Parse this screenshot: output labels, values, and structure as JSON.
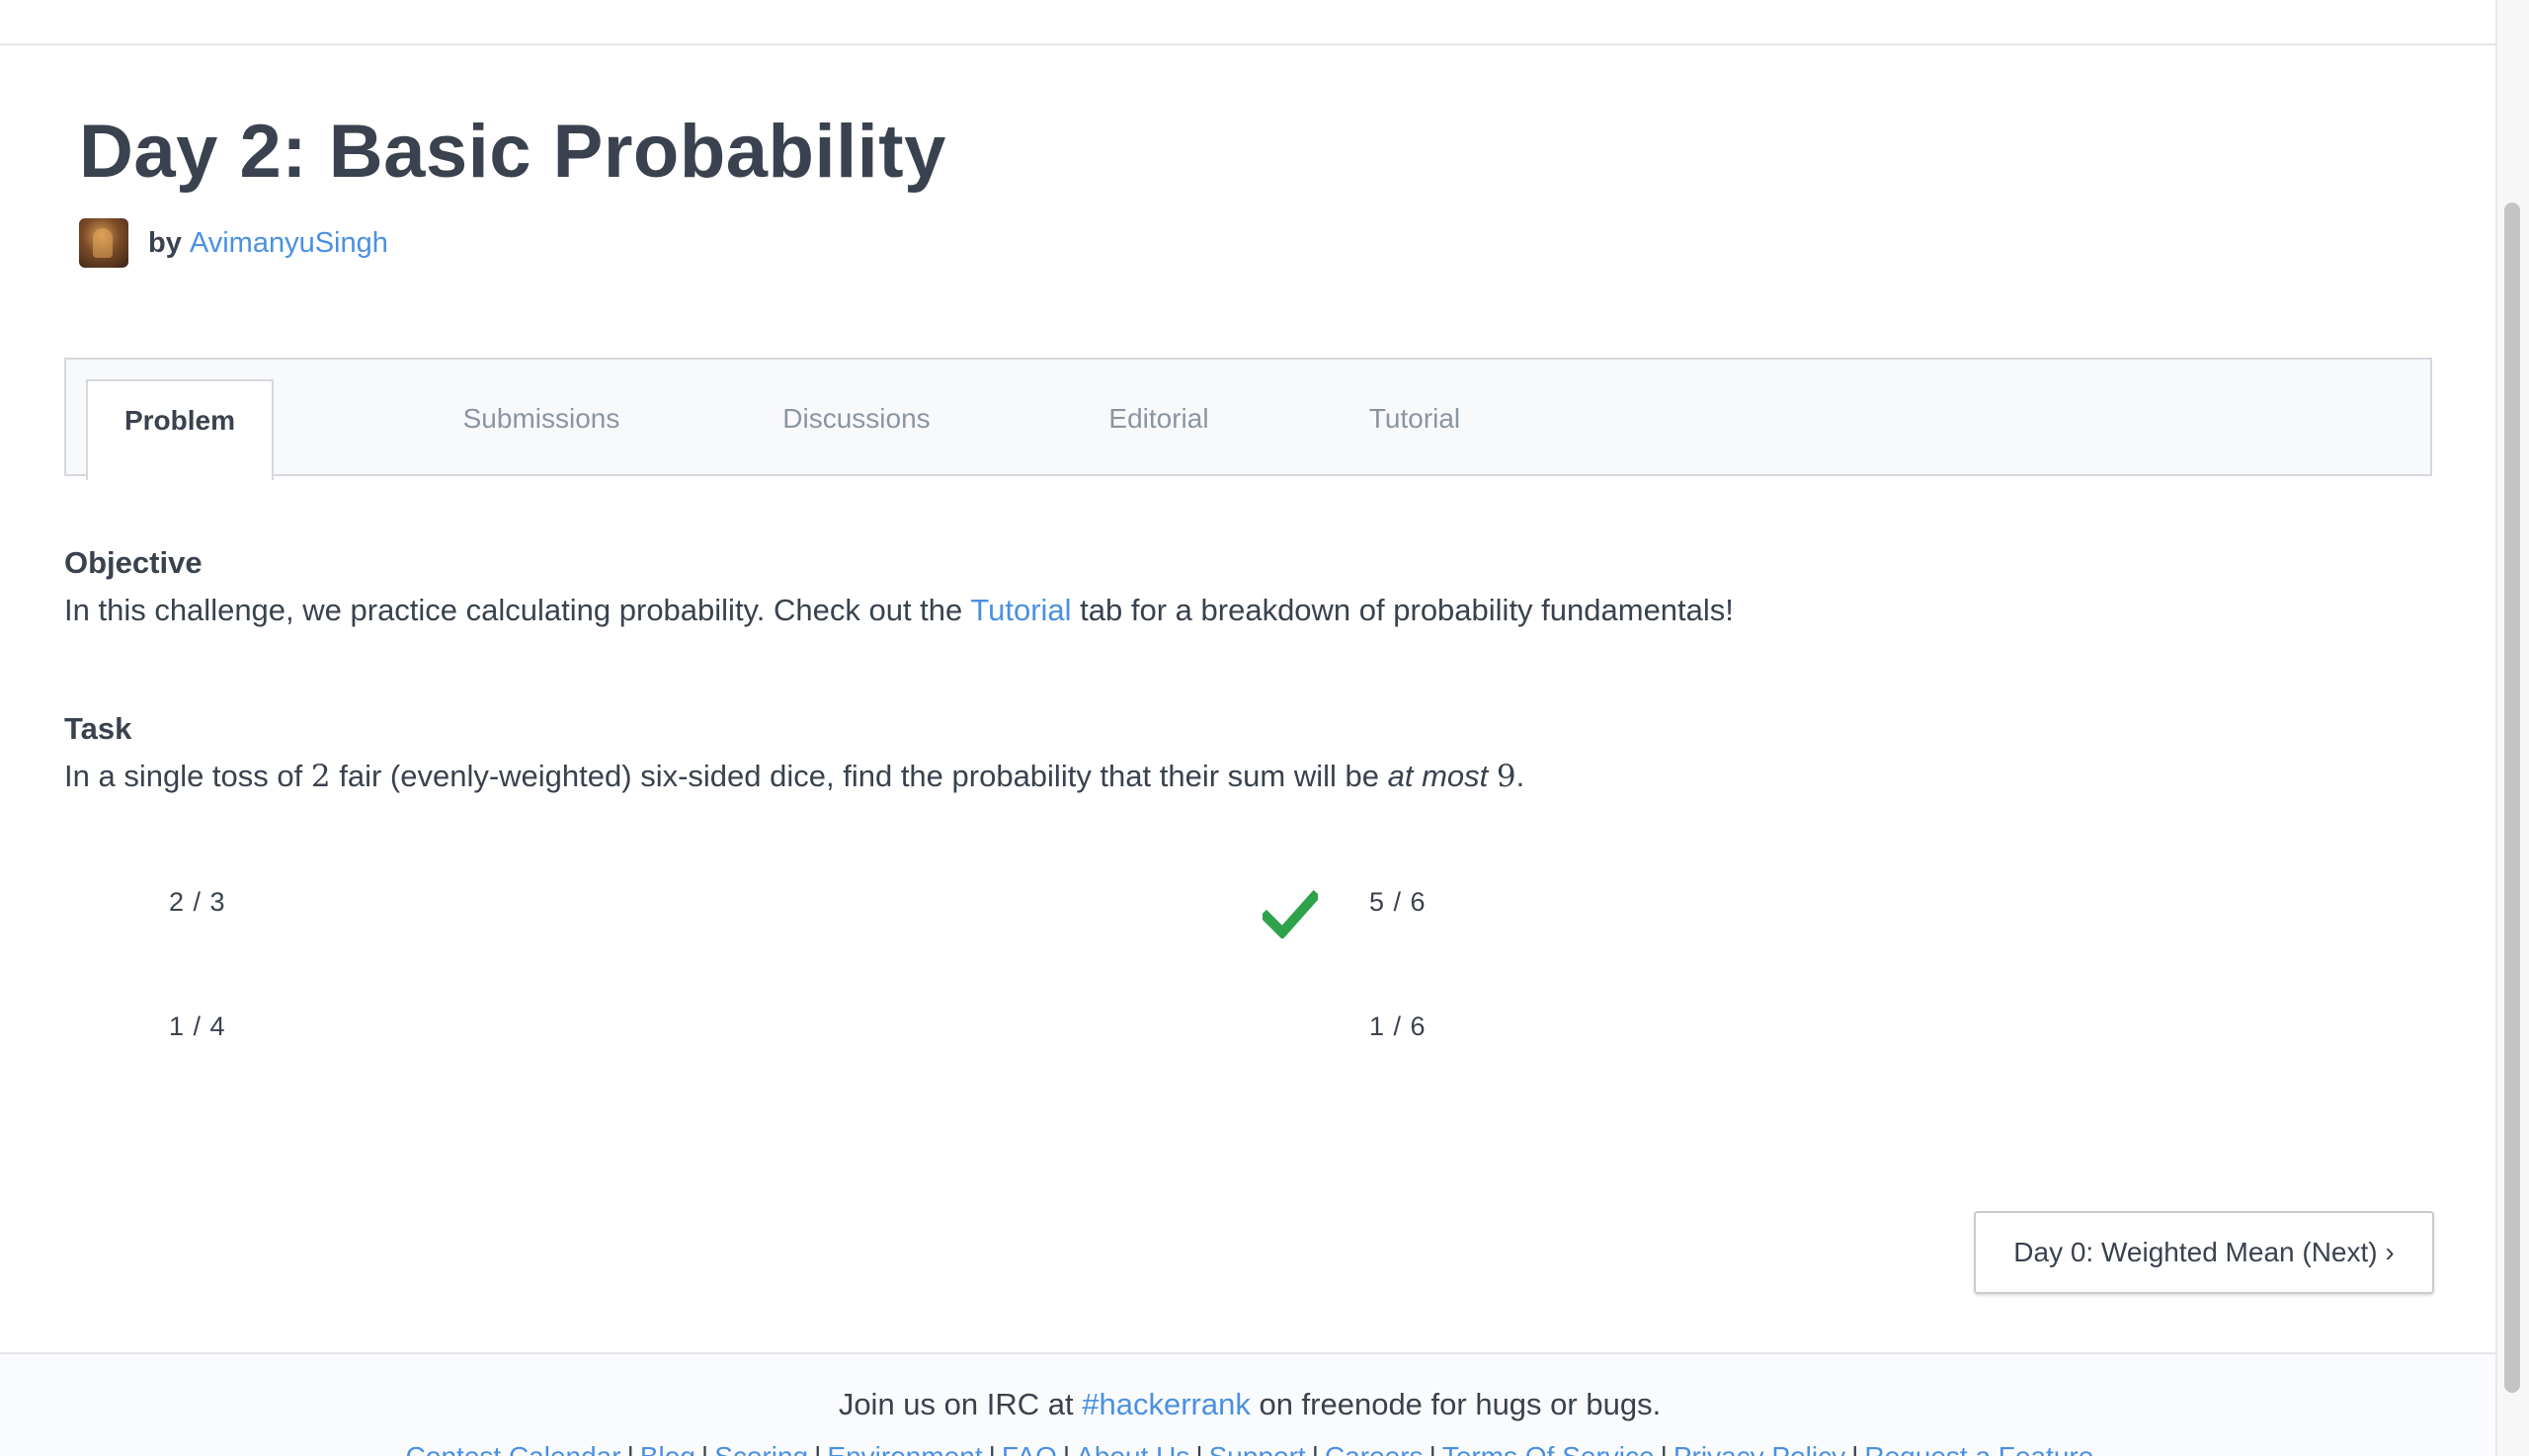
{
  "challenge": {
    "title": "Day 2: Basic Probability",
    "author_prefix": "by",
    "author_name": "AvimanyuSingh"
  },
  "tabs": [
    {
      "label": "Problem",
      "active": true
    },
    {
      "label": "Submissions",
      "active": false
    },
    {
      "label": "Discussions",
      "active": false
    },
    {
      "label": "Editorial",
      "active": false
    },
    {
      "label": "Tutorial",
      "active": false
    }
  ],
  "objective": {
    "heading": "Objective",
    "text_before": "In this challenge, we practice calculating probability. Check out the",
    "link": "Tutorial",
    "text_after": "tab for a breakdown of probability fundamentals!"
  },
  "task": {
    "heading": "Task",
    "part1": "In a single toss of",
    "num_dice": "2",
    "part2": "fair (evenly-weighted) six-sided dice, find the probability that their sum will be",
    "emphasis": "at most",
    "max_sum": "9",
    "end": "."
  },
  "options": [
    {
      "label": "2 / 3",
      "selected": false
    },
    {
      "label": "5 / 6",
      "selected": true
    },
    {
      "label": "1 / 4",
      "selected": false
    },
    {
      "label": "1 / 6",
      "selected": false
    }
  ],
  "icons": {
    "correct": "checkmark-icon",
    "correct_color": "#2ea24a"
  },
  "next_button": {
    "label": "Day 0: Weighted Mean (Next) ›"
  },
  "footer": {
    "irc_before": "Join us on IRC at",
    "irc_channel": "#hackerrank",
    "irc_after": "on freenode for hugs or bugs.",
    "links": [
      "Contest Calendar",
      "Blog",
      "Scoring",
      "Environment",
      "FAQ",
      "About Us",
      "Support",
      "Careers",
      "Terms Of Service",
      "Privacy Policy",
      "Request a Feature"
    ],
    "separator": "|"
  },
  "colors": {
    "link": "#4a90e2",
    "text": "#39424e",
    "tab_inactive": "#8b95a1"
  }
}
